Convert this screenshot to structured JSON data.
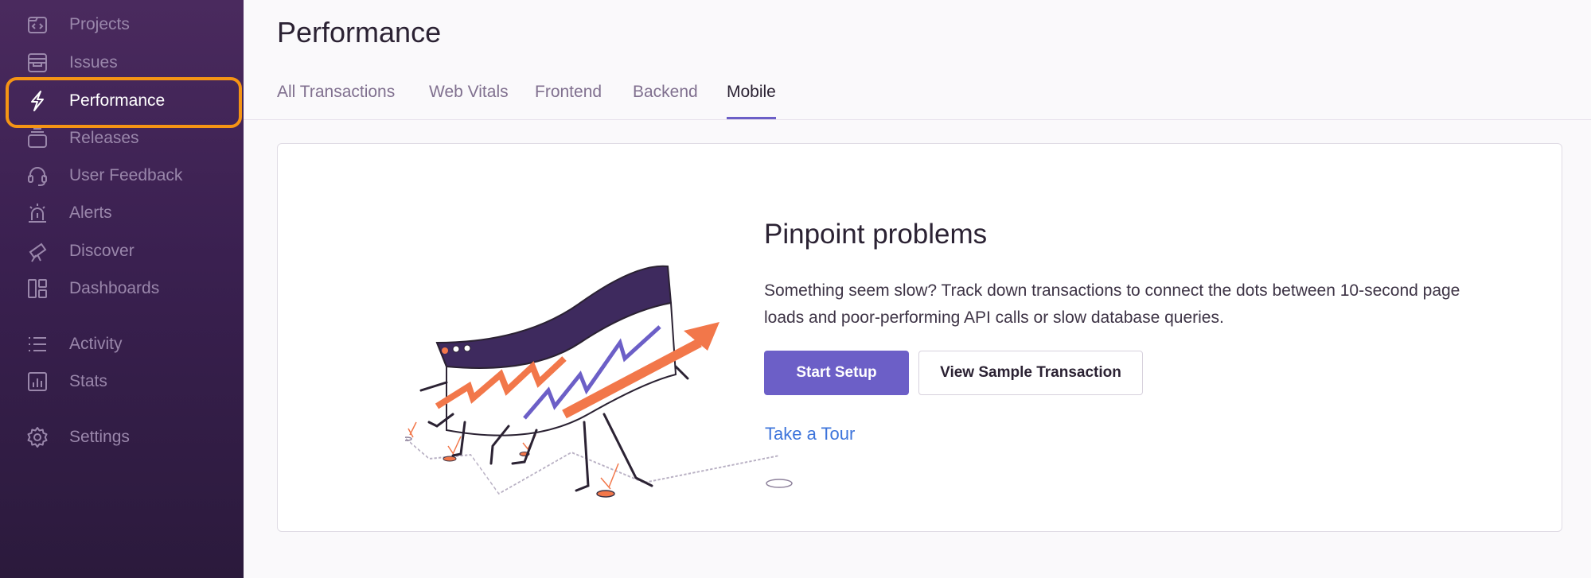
{
  "sidebar": {
    "items": [
      {
        "label": "Projects",
        "icon": "projects-icon"
      },
      {
        "label": "Issues",
        "icon": "issues-icon"
      },
      {
        "label": "Performance",
        "icon": "lightning-icon",
        "active": true
      },
      {
        "label": "Releases",
        "icon": "releases-icon"
      },
      {
        "label": "User Feedback",
        "icon": "headset-icon"
      },
      {
        "label": "Alerts",
        "icon": "siren-icon"
      },
      {
        "label": "Discover",
        "icon": "telescope-icon"
      },
      {
        "label": "Dashboards",
        "icon": "dashboards-icon"
      },
      {
        "label": "Activity",
        "icon": "list-icon"
      },
      {
        "label": "Stats",
        "icon": "bar-chart-icon"
      },
      {
        "label": "Settings",
        "icon": "gear-icon"
      }
    ],
    "highlight_color": "#f59414"
  },
  "header": {
    "title": "Performance",
    "tabs": [
      {
        "label": "All Transactions"
      },
      {
        "label": "Web Vitals"
      },
      {
        "label": "Frontend"
      },
      {
        "label": "Backend"
      },
      {
        "label": "Mobile",
        "active": true
      }
    ]
  },
  "onboarding": {
    "title": "Pinpoint problems",
    "description": "Something seem slow? Track down transactions to connect the dots between 10-second page loads and poor-performing API calls or slow database queries.",
    "primary_button": "Start Setup",
    "secondary_button": "View Sample Transaction",
    "tour_link": "Take a Tour"
  },
  "colors": {
    "accent": "#6c5fc7",
    "link": "#3d74db",
    "sidebar_bg": "#3a2050",
    "illustration_orange": "#f2774a"
  }
}
